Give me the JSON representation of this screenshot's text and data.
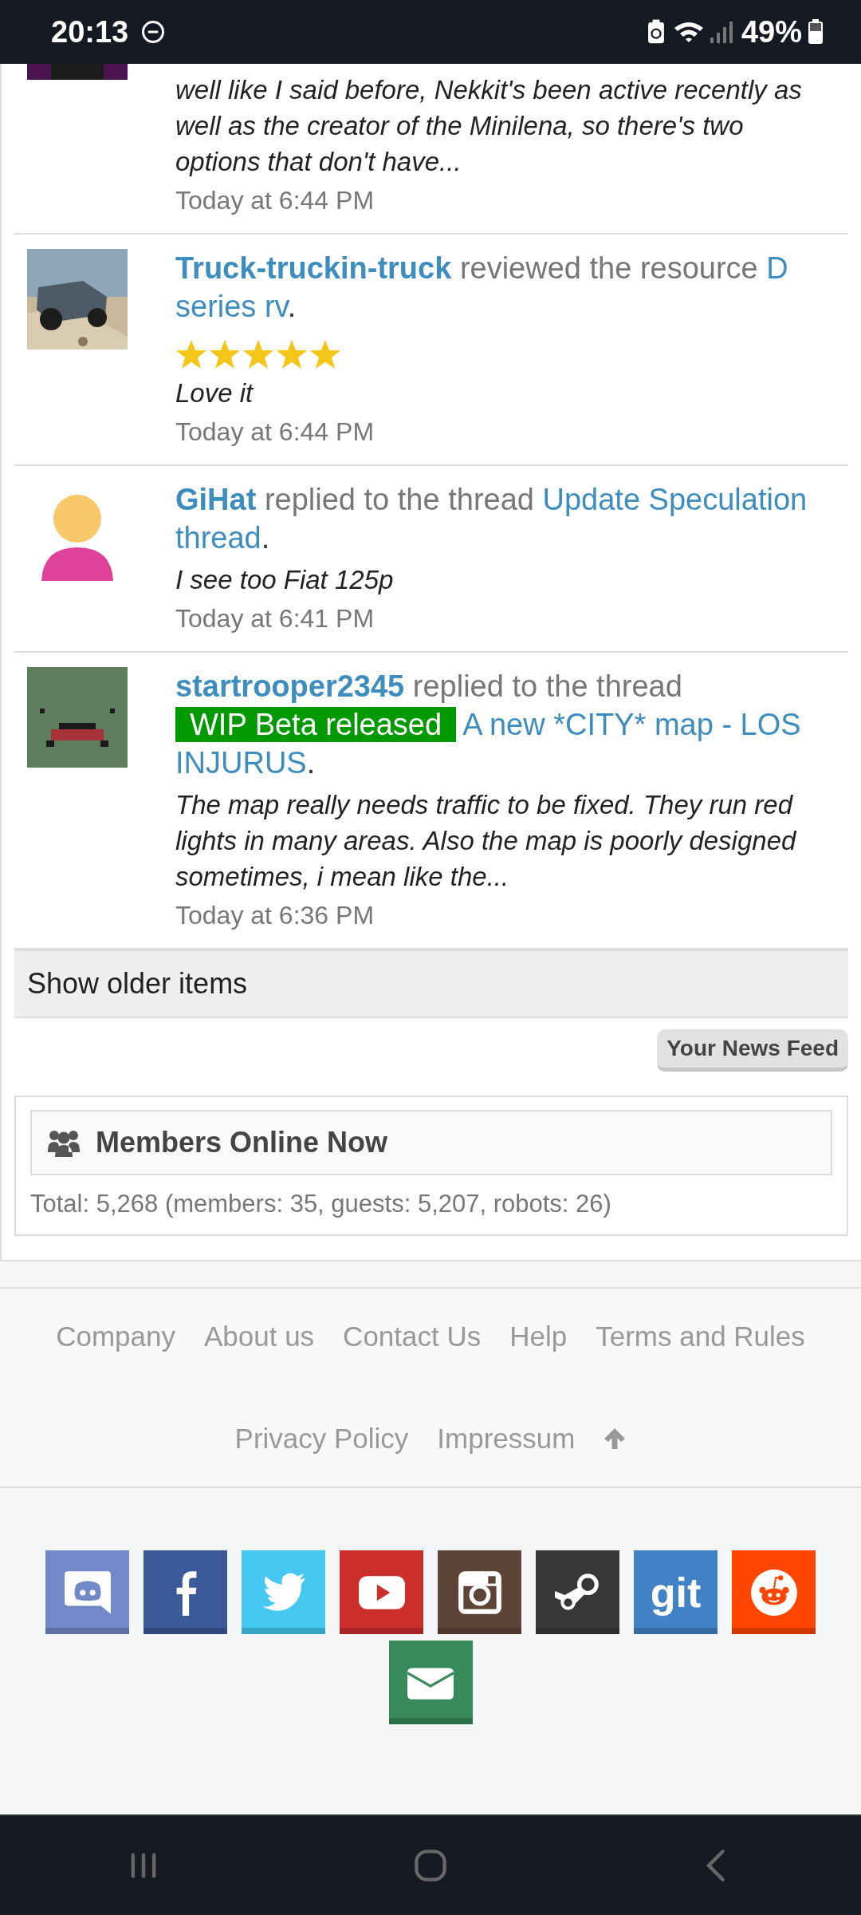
{
  "status_bar": {
    "time": "20:13",
    "battery": "49%"
  },
  "feed": [
    {
      "kind": "partial",
      "quote": "well like I said before, Nekkit's been active recently as well as the creator of the Minilena, so there's two options that don't have...",
      "date": "Today at 6:44 PM"
    },
    {
      "kind": "review",
      "actor": "Truck-truckin-truck",
      "action": "reviewed the resource",
      "target": "D series rv",
      "suffix": ".",
      "stars": 5,
      "quote": "Love it",
      "date": "Today at 6:44 PM"
    },
    {
      "kind": "reply",
      "actor": "GiHat",
      "action": "replied to the thread",
      "target": "Update Speculation thread",
      "suffix": ".",
      "quote": "I see too Fiat 125p",
      "date": "Today at 6:41 PM"
    },
    {
      "kind": "reply",
      "actor": "startrooper2345",
      "action": "replied to the thread",
      "prefix": "WIP Beta released",
      "target": "A new *CITY* map - LOS INJURUS",
      "suffix": ".",
      "quote": "The map really needs traffic to be fixed. They run red lights in many areas. Also the map is poorly designed sometimes, i mean like the...",
      "date": "Today at 6:36 PM"
    }
  ],
  "show_older": "Show older items",
  "news_feed_button": "Your News Feed",
  "members_online": {
    "title": "Members Online Now",
    "total": "Total: 5,268 (members: 35, guests: 5,207, robots: 26)"
  },
  "footer_links": [
    "Company",
    "About us",
    "Contact Us",
    "Help",
    "Terms and Rules",
    "Privacy Policy",
    "Impressum"
  ],
  "social": [
    {
      "kind": "discord",
      "color": "#7289c9"
    },
    {
      "kind": "facebook",
      "color": "#3b5998"
    },
    {
      "kind": "twitter",
      "color": "#44c8f2"
    },
    {
      "kind": "youtube",
      "color": "#cc2e2c"
    },
    {
      "kind": "instagram",
      "color": "#5e4436"
    },
    {
      "kind": "steam",
      "color": "#373737"
    },
    {
      "kind": "git",
      "color": "#4183c4",
      "label": "git"
    },
    {
      "kind": "reddit",
      "color": "#ff4500"
    },
    {
      "kind": "mail",
      "color": "#378a5a"
    }
  ]
}
